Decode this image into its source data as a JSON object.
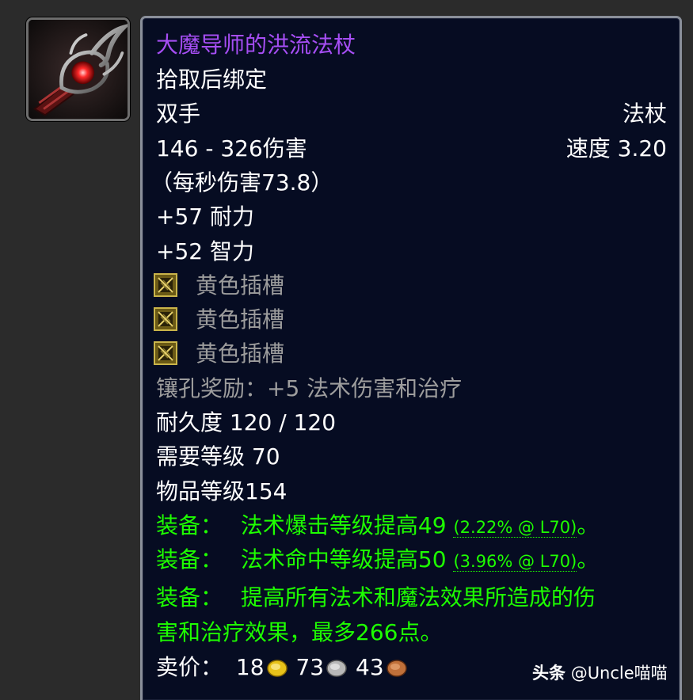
{
  "item": {
    "name": "大魔导师的洪流法杖",
    "quality_color": "#a64ef4",
    "icon": "staff-icon",
    "binding": "拾取后绑定",
    "slot": "双手",
    "type": "法杖",
    "damage": "146 - 326伤害",
    "speed": "速度 3.20",
    "dps": "（每秒伤害73.8）",
    "stats": [
      "+57 耐力",
      "+52 智力"
    ],
    "sockets": [
      {
        "icon": "yellow-socket-icon",
        "label": "黄色插槽"
      },
      {
        "icon": "yellow-socket-icon",
        "label": "黄色插槽"
      },
      {
        "icon": "yellow-socket-icon",
        "label": "黄色插槽"
      }
    ],
    "socket_bonus": "镶孔奖励：+5 法术伤害和治疗",
    "durability": "耐久度 120 / 120",
    "required_level": "需要等级 70",
    "item_level": "物品等级154",
    "equip_effects": [
      {
        "label": "装备：",
        "text": "法术爆击等级提高49",
        "detail": "(2.22% @ L70)",
        "suffix": "。"
      },
      {
        "label": "装备：",
        "text": "法术命中等级提高50",
        "detail": "(3.96% @ L70)",
        "suffix": "。"
      },
      {
        "label": "装备：",
        "text": "提高所有法术和魔法效果所造成的伤",
        "text_cont": "害和治疗效果，最多266点。"
      }
    ],
    "sell_price": {
      "label": "卖价：",
      "gold": "18",
      "silver": "73",
      "copper": "43",
      "gold_icon": "gold-coin-icon",
      "silver_icon": "silver-coin-icon",
      "copper_icon": "copper-coin-icon"
    }
  },
  "watermark": {
    "brand": "头条",
    "handle": "@Uncle喵喵"
  },
  "colors": {
    "epic": "#a64ef4",
    "green": "#1eff00",
    "gray": "#9d9d9d",
    "white": "#ffffff",
    "tooltip_bg": "#060c22"
  }
}
